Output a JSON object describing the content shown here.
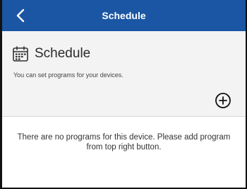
{
  "navbar": {
    "title": "Schedule",
    "back_icon": "chevron-left-icon",
    "background_color": "#1a56a3"
  },
  "header": {
    "icon": "calendar-icon",
    "title": "Schedule",
    "subtitle": "You can set programs for your devices.",
    "add_icon": "add-circle-icon"
  },
  "main": {
    "empty_message": "There are no programs for this device. Please add program from top right button."
  }
}
